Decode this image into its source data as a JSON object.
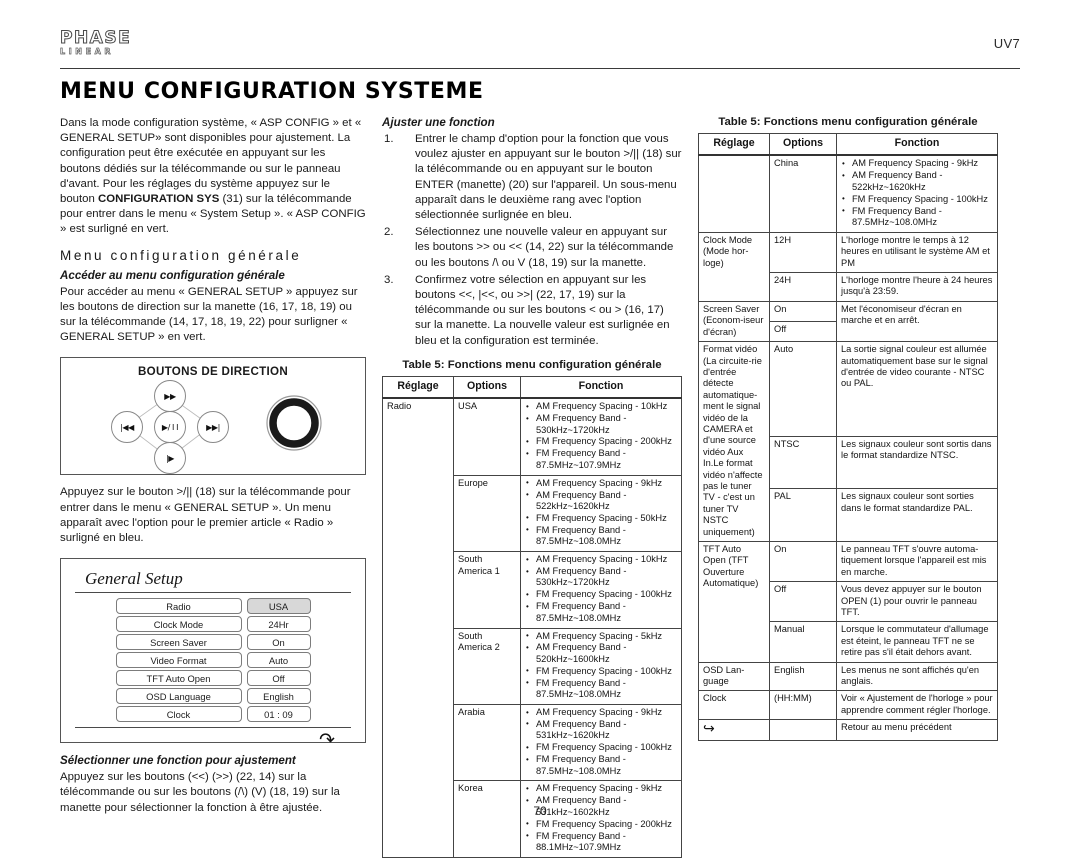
{
  "header": {
    "logo_main": "PHASE",
    "logo_sub": "LINEAR",
    "model_code": "UV7"
  },
  "title": "MENU CONFIGURATION SYSTEME",
  "page_number": "70",
  "left_column": {
    "intro_paragraph_1": "Dans la mode configuration système, « ASP CONFIG » et « GENERAL SETUP» sont disponibles pour ajustement. La configuration peut être exécutée en appuyant sur les boutons dédiés sur la télécommande ou sur le panneau d'avant. Pour les réglages du système appuyez sur le bouton ",
    "intro_bold": "CONFIGURATION SYS",
    "intro_paragraph_2": " (31) sur la télécommande pour entrer dans le menu « System Setup ». « ASP CONFIG » est surligné en vert.",
    "section_heading": "Menu configuration générale",
    "sub_heading_1": "Accéder au menu configuration générale",
    "paragraph_2": "Pour accéder au menu « GENERAL SETUP » appuyez sur les boutons de direction sur la manette (16, 17, 18, 19) ou sur la télécommande (14, 17, 18, 19, 22) pour surligner « GENERAL SETUP » en vert.",
    "dir_box_title": "BOUTONS DE DIRECTION",
    "dpad": {
      "up": "▶▶",
      "left": "|◀◀",
      "middle": "▶/ I I",
      "right": "▶▶|",
      "down": "|▶"
    },
    "paragraph_3": "Appuyez sur le bouton >/|| (18) sur la télécommande pour entrer dans le menu « GENERAL SETUP ». Un menu apparaît avec l'option pour le premier article « Radio » surligné en bleu.",
    "general_setup_screen": {
      "title": "General Setup",
      "rows": [
        {
          "label": "Radio",
          "value": "USA",
          "selected": true
        },
        {
          "label": "Clock  Mode",
          "value": "24Hr",
          "selected": false
        },
        {
          "label": "Screen Saver",
          "value": "On",
          "selected": false
        },
        {
          "label": "Video Format",
          "value": "Auto",
          "selected": false
        },
        {
          "label": "TFT Auto Open",
          "value": "Off",
          "selected": false
        },
        {
          "label": "OSD Language",
          "value": "English",
          "selected": false
        },
        {
          "label": "Clock",
          "value": "01 :  09",
          "selected": false
        }
      ],
      "back_icon": "↶"
    },
    "sub_heading_2": "Sélectionner une fonction pour ajustement",
    "paragraph_4": "Appuyez sur les boutons (<<) (>>) (22, 14) sur la télécommande ou sur les boutons (/\\) (V)  (18, 19) sur la manette pour sélectionner la fonction à être ajustée."
  },
  "middle_column": {
    "sub_heading": "Ajuster une fonction",
    "steps": [
      {
        "num": "1.",
        "text": "Entrer le champ d'option pour la fonction que vous voulez ajuster en appuyant sur le bouton >/|| (18) sur la télécommande ou en appuyant sur le bouton ENTER (manette) (20) sur l'appareil. Un sous-menu apparaît dans le deuxième rang avec l'option sélectionnée surlignée en bleu."
      },
      {
        "num": "2.",
        "text": "Sélectionnez une nouvelle valeur en appuyant sur les boutons >> ou << (14, 22) sur la télécommande ou les boutons /\\ ou V (18, 19) sur la manette."
      },
      {
        "num": "3.",
        "text": "Confirmez votre sélection en appuyant sur les boutons <<, |<<, ou >>| (22, 17, 19) sur la télécommande ou sur les boutons < ou > (16, 17) sur la manette. La nouvelle valeur est surlignée en bleu et la configuration est terminée."
      }
    ],
    "table_caption": "Table 5: Fonctions menu configuration générale",
    "table_headers": [
      "Réglage",
      "Options",
      "Fonction"
    ],
    "table_rows": [
      {
        "reglage": "Radio",
        "reglage_rowspan": 6,
        "options": "USA",
        "fonction_items": [
          "AM Frequency Spacing - 10kHz",
          "AM Frequency Band - 530kHz~1720kHz",
          "FM Frequency Spacing - 200kHz",
          "FM Frequency Band - 87.5MHz~107.9MHz"
        ]
      },
      {
        "options": "Europe",
        "fonction_items": [
          "AM Frequency Spacing - 9kHz",
          "AM Frequency Band - 522kHz~1620kHz",
          "FM Frequency Spacing - 50kHz",
          "FM Frequency Band - 87.5MHz~108.0MHz"
        ]
      },
      {
        "options": "South America 1",
        "fonction_items": [
          "AM Frequency Spacing - 10kHz",
          "AM Frequency Band - 530kHz~1720kHz",
          "FM Frequency Spacing - 100kHz",
          "FM Frequency Band - 87.5MHz~108.0MHz"
        ]
      },
      {
        "options": "South America 2",
        "fonction_items": [
          "AM Frequency Spacing - 5kHz",
          "AM Frequency Band - 520kHz~1600kHz",
          "FM Frequency Spacing - 100kHz",
          "FM Frequency Band - 87.5MHz~108.0MHz"
        ]
      },
      {
        "options": "Arabia",
        "fonction_items": [
          "AM Frequency Spacing - 9kHz",
          "AM Frequency Band - 531kHz~1620kHz",
          "FM Frequency Spacing - 100kHz",
          "FM Frequency Band - 87.5MHz~108.0MHz"
        ]
      },
      {
        "options": "Korea",
        "fonction_items": [
          "AM Frequency Spacing - 9kHz",
          "AM Frequency Band - 531kHz~1602kHz",
          "FM Frequency Spacing - 200kHz",
          "FM Frequency Band - 88.1MHz~107.9MHz"
        ]
      }
    ]
  },
  "right_column": {
    "table_caption": "Table 5: Fonctions menu configuration générale",
    "table_headers": [
      "Réglage",
      "Options",
      "Fonction"
    ],
    "table_rows": [
      {
        "reglage": "",
        "options": "China",
        "fonction_items": [
          "AM Frequency Spacing - 9kHz",
          "AM Frequency Band - 522kHz~1620kHz",
          "FM Frequency Spacing - 100kHz",
          "FM Frequency Band - 87.5MHz~108.0MHz"
        ]
      },
      {
        "reglage": "Clock Mode (Mode hor-loge)",
        "reglage_rowspan": 2,
        "options": "12H",
        "fonction": "L'horloge montre le temps à 12 heures en utilisant le système AM et PM"
      },
      {
        "options": "24H",
        "fonction": "L'horloge montre l'heure à 24 heures jusqu'à 23:59."
      },
      {
        "reglage": "Screen Saver (Econom-iseur d'écran)",
        "reglage_rowspan": 2,
        "options": "On",
        "fonction": "Met l'économiseur d'écran en marche et en arrêt.",
        "fonction_rowspan": 2
      },
      {
        "options": "Off"
      },
      {
        "reglage": "Format vidéo (La circuite-rie d'entrée détecte automatique-ment le signal vidéo de la CAMERA et d'une source vidéo Aux In.Le format vidéo n'affecte pas le tuner TV - c'est un tuner TV NSTC uniquement)",
        "reglage_rowspan": 3,
        "options": "Auto",
        "fonction": "La sortie signal couleur est allumée automatiquement base sur le signal d'entrée de video courante - NTSC ou PAL."
      },
      {
        "options": "NTSC",
        "fonction": "Les signaux couleur sont sortis dans le format standardize NTSC."
      },
      {
        "options": "PAL",
        "fonction": "Les signaux couleur sont sorties dans le format standardize PAL."
      },
      {
        "reglage": "TFT Auto Open (TFT Ouverture Automatique)",
        "reglage_rowspan": 3,
        "options": "On",
        "fonction": "Le panneau TFT s'ouvre automa-tiquement lorsque l'appareil est mis en marche."
      },
      {
        "options": "Off",
        "fonction": "Vous devez appuyer sur le bouton OPEN (1) pour ouvrir le panneau TFT."
      },
      {
        "options": "Manual",
        "fonction": "Lorsque le commutateur d'allumage est éteint, le panneau TFT ne se retire pas  s'il était dehors avant."
      },
      {
        "reglage": "OSD Lan-guage",
        "options": "English",
        "fonction": "Les menus ne sont affichés qu'en anglais."
      },
      {
        "reglage": "Clock",
        "options": "(HH:MM)",
        "fonction": "Voir « Ajustement de l'horloge » pour apprendre comment régler l'horloge."
      },
      {
        "reglage_icon": "back-arrow-icon",
        "options": "",
        "fonction": "Retour au menu précédent"
      }
    ]
  }
}
